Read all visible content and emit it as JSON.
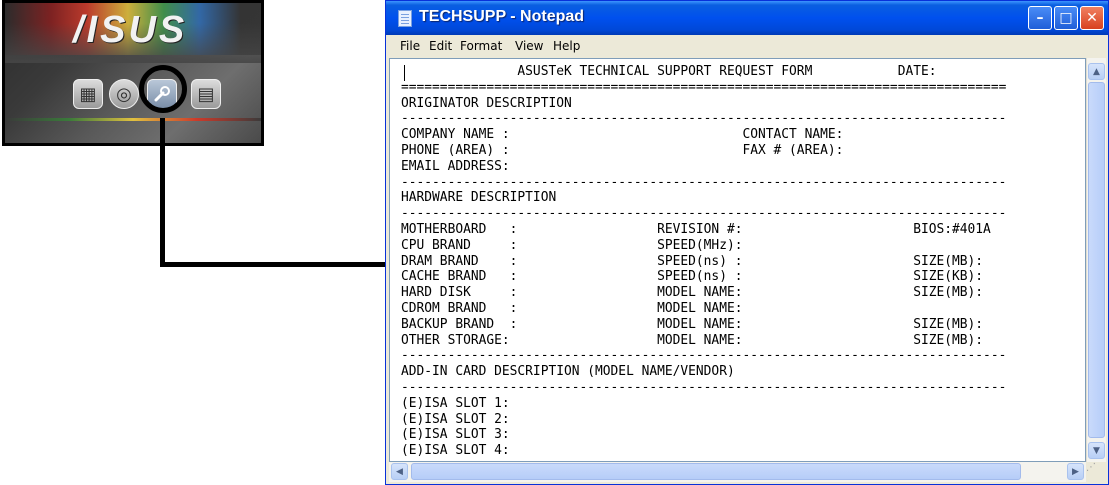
{
  "asus_panel": {
    "logo_text": "/ISUS",
    "buttons": [
      {
        "icon": "calendar-icon"
      },
      {
        "icon": "disc-icon"
      },
      {
        "icon": "wrench-icon",
        "highlighted": true
      },
      {
        "icon": "notes-icon"
      }
    ]
  },
  "window": {
    "title": "TECHSUPP - Notepad",
    "controls": {
      "minimize": "–",
      "maximize": "□",
      "close": "✕"
    }
  },
  "menu": [
    "File",
    "Edit",
    "Format",
    "View",
    "Help"
  ],
  "editor": {
    "lines": [
      "               ASUSTeK TECHNICAL SUPPORT REQUEST FORM           DATE:",
      "==============================================================================",
      "ORIGINATOR DESCRIPTION",
      "------------------------------------------------------------------------------",
      "COMPANY NAME :                              CONTACT NAME:",
      "PHONE (AREA) :                              FAX # (AREA):",
      "EMAIL ADDRESS:",
      "------------------------------------------------------------------------------",
      "HARDWARE DESCRIPTION",
      "------------------------------------------------------------------------------",
      "MOTHERBOARD   :                  REVISION #:                      BIOS:#401A",
      "CPU BRAND     :                  SPEED(MHz):",
      "DRAM BRAND    :                  SPEED(ns) :                      SIZE(MB):",
      "CACHE BRAND   :                  SPEED(ns) :                      SIZE(KB):",
      "HARD DISK     :                  MODEL NAME:                      SIZE(MB):",
      "CDROM BRAND   :                  MODEL NAME:",
      "BACKUP BRAND  :                  MODEL NAME:                      SIZE(MB):",
      "OTHER STORAGE:                   MODEL NAME:                      SIZE(MB):",
      "------------------------------------------------------------------------------",
      "ADD-IN CARD DESCRIPTION (MODEL NAME/VENDOR)",
      "------------------------------------------------------------------------------",
      "(E)ISA SLOT 1:",
      "(E)ISA SLOT 2:",
      "(E)ISA SLOT 3:",
      "(E)ISA SLOT 4:"
    ]
  },
  "scrollbars": {
    "up": "▲",
    "down": "▼",
    "left": "◀",
    "right": "▶",
    "grip": "⋰"
  },
  "colors": {
    "titlebar": "#0050ee",
    "close_button": "#d8411e",
    "window_frame": "#ece9d8"
  }
}
